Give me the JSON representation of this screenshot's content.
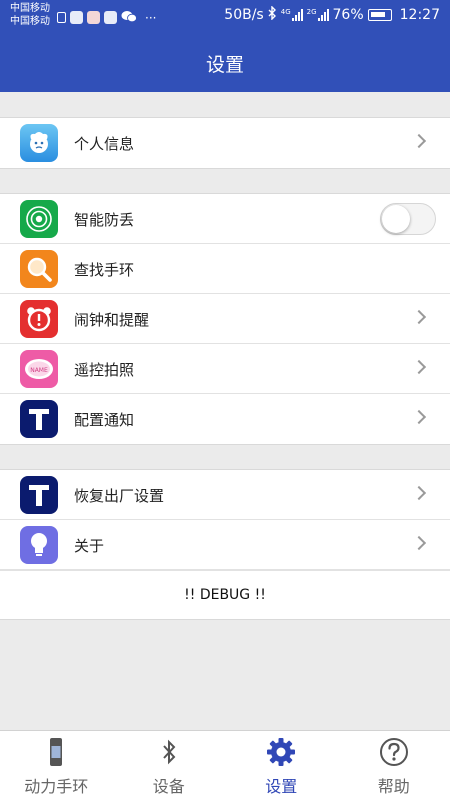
{
  "status_bar": {
    "carrier1": "中国移动",
    "carrier2": "中国移动",
    "more": "···",
    "speed": "50B/s",
    "net1": "4G",
    "net2": "2G",
    "battery": "76%",
    "time": "12:27"
  },
  "header": {
    "title": "设置"
  },
  "groups": {
    "profile": {
      "label": "个人信息"
    },
    "device": {
      "anti_lost": {
        "label": "智能防丢",
        "toggle_on": false
      },
      "find_band": {
        "label": "查找手环"
      },
      "alarm": {
        "label": "闹钟和提醒"
      },
      "remote_camera": {
        "label": "遥控拍照",
        "icon_text": "NAME"
      },
      "notify_config": {
        "label": "配置通知"
      }
    },
    "system": {
      "factory_reset": {
        "label": "恢复出厂设置"
      },
      "about": {
        "label": "关于"
      },
      "debug": {
        "label": "!! DEBUG !!"
      }
    }
  },
  "bottom_nav": {
    "items": [
      {
        "label": "动力手环",
        "icon": "band-icon"
      },
      {
        "label": "设备",
        "icon": "bluetooth-icon"
      },
      {
        "label": "设置",
        "icon": "gear-icon",
        "active": true
      },
      {
        "label": "帮助",
        "icon": "help-icon"
      }
    ]
  },
  "colors": {
    "header": "#3150b8",
    "active_nav": "#3047b6",
    "background": "#ebebeb"
  }
}
